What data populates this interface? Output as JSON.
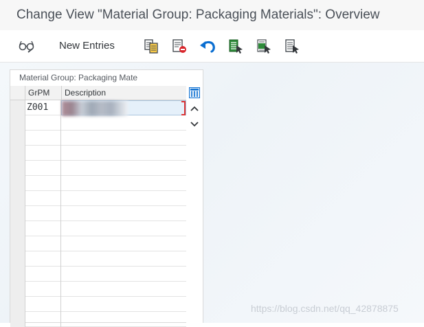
{
  "window": {
    "title": "Change View \"Material Group: Packaging Materials\": Overview"
  },
  "toolbar": {
    "items": [
      {
        "icon": "glasses-icon"
      },
      {
        "label": "New Entries"
      },
      {
        "icon": "copy-icon"
      },
      {
        "icon": "delete-icon"
      },
      {
        "icon": "undo-icon"
      },
      {
        "icon": "select-all-icon"
      },
      {
        "icon": "select-block-icon"
      },
      {
        "icon": "deselect-all-icon"
      }
    ]
  },
  "table": {
    "title": "Material Group: Packaging Mate",
    "columns": [
      "GrPM",
      "Description"
    ],
    "rows": [
      {
        "grpm": "Z001",
        "description": ""
      }
    ]
  },
  "colors": {
    "accent": "#0a6ed1",
    "active_cell": "#e5f0fa",
    "focus_marker": "#dd3333",
    "icon_green": "#2e8b3a"
  },
  "watermark": "https://blog.csdn.net/qq_42878875"
}
